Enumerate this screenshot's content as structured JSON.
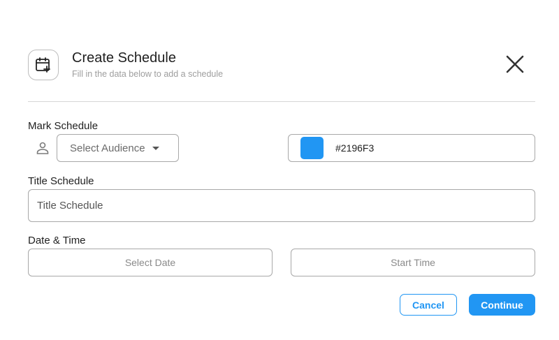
{
  "header": {
    "title": "Create Schedule",
    "subtitle": "Fill in the data below to add a schedule",
    "icon": "calendar-add-icon",
    "close_icon": "close-icon"
  },
  "mark_schedule": {
    "label": "Mark Schedule",
    "audience_icon": "person-icon",
    "audience_placeholder": "Select Audience",
    "color_value": "#2196F3",
    "color_hex_text": "#2196F3"
  },
  "title_schedule": {
    "label": "Title Schedule",
    "placeholder": "Title Schedule"
  },
  "date_time": {
    "label": "Date & Time",
    "date_placeholder": "Select Date",
    "time_placeholder": "Start Time"
  },
  "actions": {
    "cancel_label": "Cancel",
    "continue_label": "Continue"
  },
  "colors": {
    "accent": "#2196F3"
  }
}
